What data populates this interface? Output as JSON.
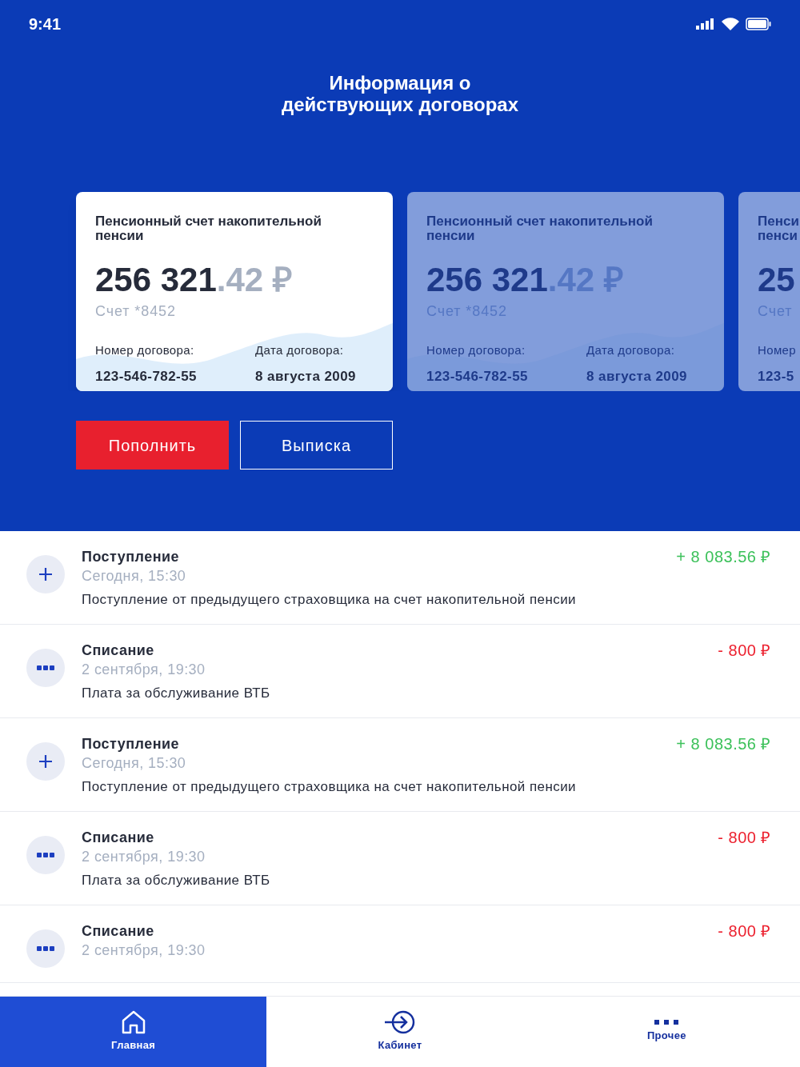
{
  "status_bar": {
    "time": "9:41"
  },
  "title": "Информация о действующих договорах",
  "cards": [
    {
      "selected": true,
      "title": [
        "Пенсионный счет накопительной",
        "пенсии"
      ],
      "amount": "256 321",
      "fraction": ".42 ₽",
      "account": "Счет *8452",
      "contract_label": "Номер договора:",
      "contract": "123-546-782-55",
      "date_label": "Дата договора:",
      "date": "8 августа 2009"
    },
    {
      "selected": false,
      "title": [
        "Пенсионный счет накопительной",
        "пенсии"
      ],
      "amount": "256 321",
      "fraction": ".42 ₽",
      "account": "Счет *8452",
      "contract_label": "Номер договора:",
      "contract": "123-546-782-55",
      "date_label": "Дата договора:",
      "date": "8 августа 2009"
    },
    {
      "selected": false,
      "title": [
        "Пенси",
        "пенси"
      ],
      "amount": "25",
      "account": "Счет",
      "contract_label": "Номер",
      "contract": "123-5"
    }
  ],
  "buttons": [
    {
      "kind": "primary",
      "label": "Пополнить"
    },
    {
      "kind": "outline",
      "label": "Выписка"
    }
  ],
  "transactions": [
    {
      "kind": "income",
      "title": "Поступление",
      "time": "Сегодня, 15:30",
      "amount": "+ 8 083.56 ₽",
      "description": "Поступление от предыдущего страховщика на счет накопительной пенсии"
    },
    {
      "kind": "charge",
      "title": "Списание",
      "time": "2 сентября, 19:30",
      "amount": "- 800 ₽",
      "description": "Плата за обслуживание ВТБ"
    },
    {
      "kind": "income",
      "title": "Поступление",
      "time": "Сегодня, 15:30",
      "amount": "+ 8 083.56 ₽",
      "description": "Поступление от предыдущего страховщика на счет накопительной пенсии"
    },
    {
      "kind": "charge",
      "title": "Списание",
      "time": "2 сентября, 19:30",
      "amount": "- 800 ₽",
      "description": "Плата за обслуживание ВТБ"
    },
    {
      "kind": "charge",
      "title": "Списание",
      "time": "2 сентября, 19:30",
      "amount": "- 800 ₽"
    }
  ],
  "tabs": [
    {
      "kind": "home",
      "label": "Главная",
      "selected": true
    },
    {
      "kind": "cabinet",
      "label": "Кабинет",
      "selected": false
    },
    {
      "kind": "more",
      "label": "Прочее",
      "selected": false
    }
  ]
}
